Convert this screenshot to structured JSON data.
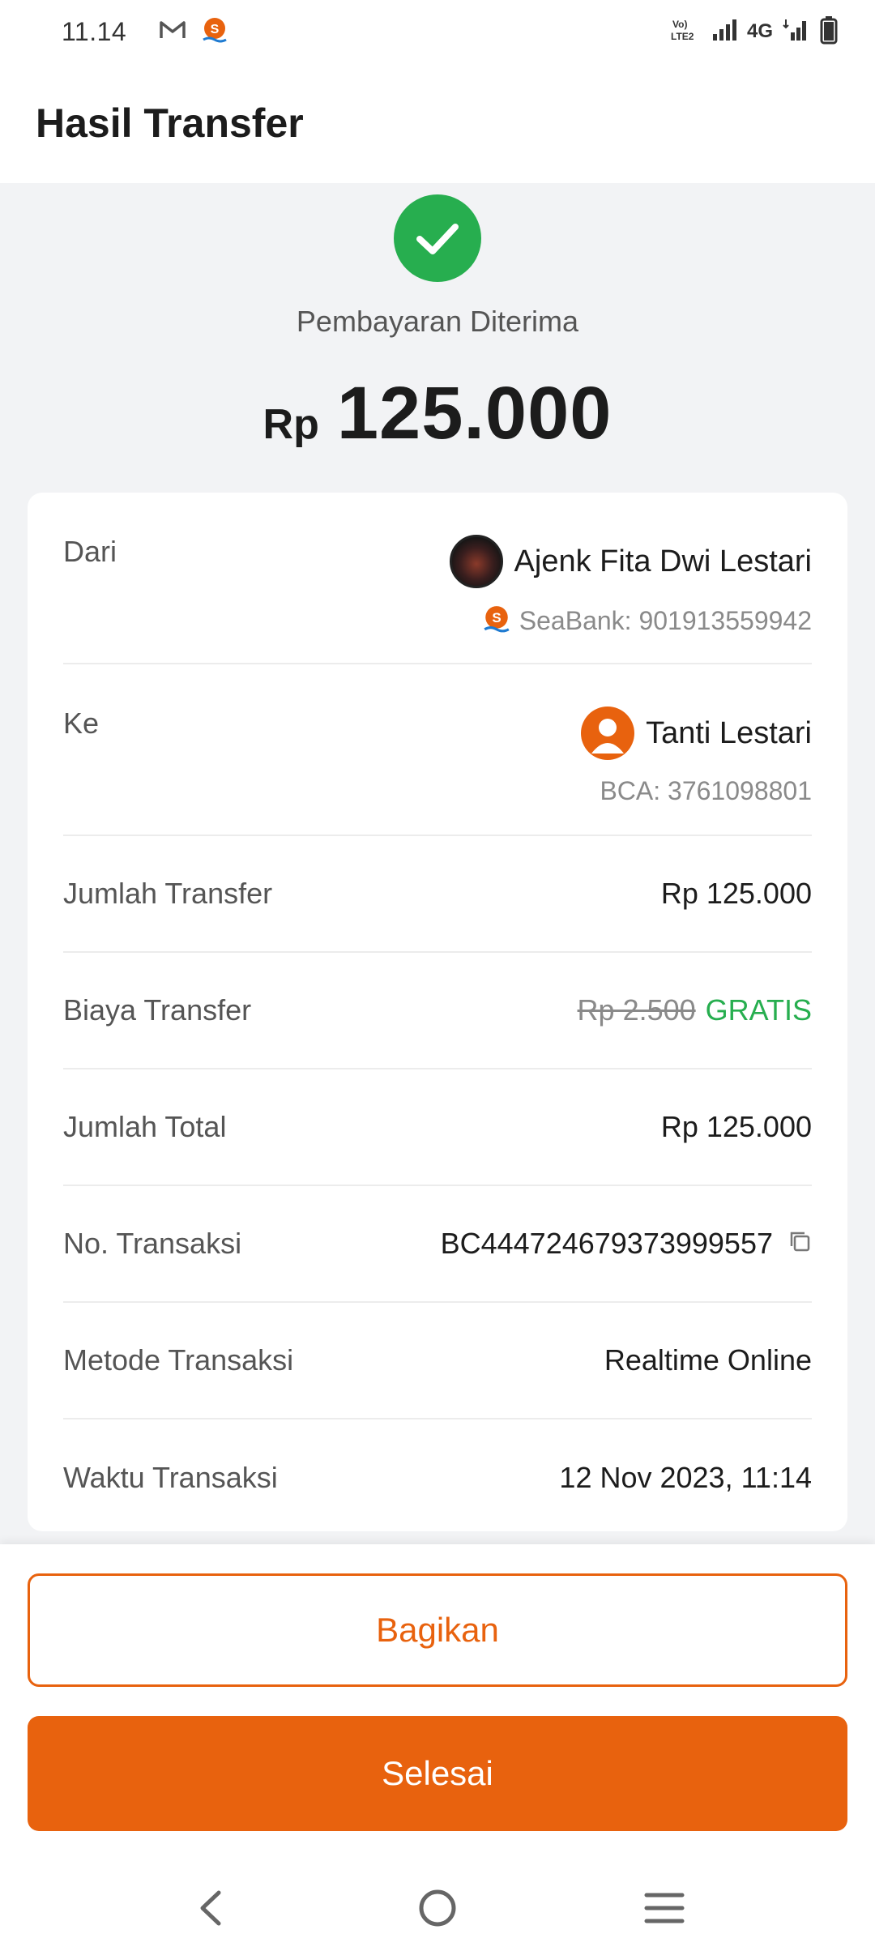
{
  "status_bar": {
    "time": "11.14",
    "network_label": "4G",
    "volte_label": "Vo) LTE2",
    "icons": [
      "gmail-icon",
      "seabank-icon",
      "volte-icon",
      "signal-icon",
      "signal-icon",
      "battery-icon"
    ]
  },
  "header": {
    "title": "Hasil Transfer"
  },
  "result": {
    "status": "Pembayaran Diterima",
    "currency": "Rp",
    "amount": "125.000",
    "icon": "check-icon"
  },
  "details": {
    "from": {
      "label": "Dari",
      "name": "Ajenk Fita Dwi Lestari",
      "account": "SeaBank: 901913559942"
    },
    "to": {
      "label": "Ke",
      "name": "Tanti Lestari",
      "account": "BCA: 3761098801"
    },
    "transfer_amount": {
      "label": "Jumlah Transfer",
      "value": "Rp 125.000"
    },
    "transfer_fee": {
      "label": "Biaya Transfer",
      "original": "Rp 2.500",
      "value": "GRATIS"
    },
    "total_amount": {
      "label": "Jumlah Total",
      "value": "Rp 125.000"
    },
    "transaction_no": {
      "label": "No. Transaksi",
      "value": "BC444724679373999557"
    },
    "method": {
      "label": "Metode Transaksi",
      "value": "Realtime Online"
    },
    "time": {
      "label": "Waktu Transaksi",
      "value": "12 Nov 2023, 11:14"
    }
  },
  "actions": {
    "share_label": "Bagikan",
    "done_label": "Selesai"
  },
  "colors": {
    "accent": "#e8620e",
    "success": "#27ae4f"
  }
}
